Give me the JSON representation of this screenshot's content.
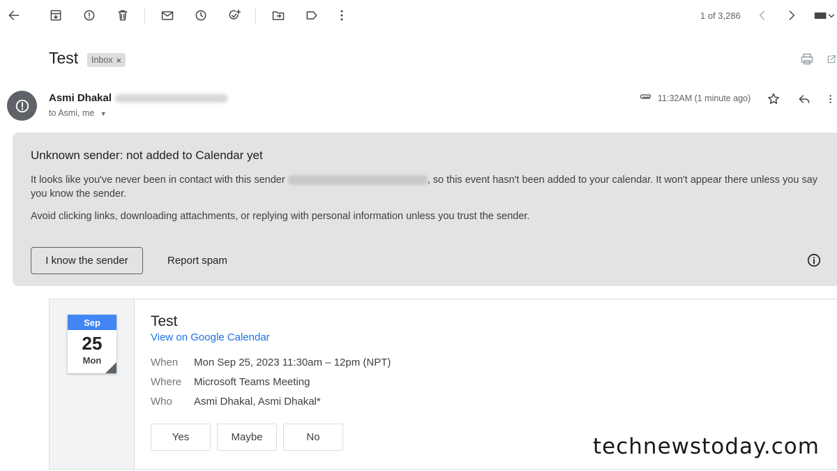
{
  "toolbar": {
    "pager": "1 of 3,286"
  },
  "message": {
    "subject": "Test",
    "label": "Inbox",
    "label_close": "×",
    "sender_name": "Asmi Dhakal",
    "recipients": "to Asmi, me",
    "time": "11:32AM (1 minute ago)"
  },
  "warning": {
    "title": "Unknown sender: not added to Calendar yet",
    "body_before": "It looks like you've never been in contact with this sender",
    "body_after": ", so this event hasn't been added to your calendar. It won't appear there unless you say you know the sender.",
    "body2": "Avoid clicking links, downloading attachments, or replying with personal information unless you trust the sender.",
    "know_button": "I know the sender",
    "spam_button": "Report spam"
  },
  "invite": {
    "cal_month": "Sep",
    "cal_day": "25",
    "cal_dow": "Mon",
    "title": "Test",
    "link": "View on Google Calendar",
    "when_label": "When",
    "when_value": "Mon Sep 25, 2023 11:30am – 12pm (NPT)",
    "where_label": "Where",
    "where_value": "Microsoft Teams Meeting",
    "who_label": "Who",
    "who_value": "Asmi Dhakal, Asmi Dhakal*",
    "yes": "Yes",
    "maybe": "Maybe",
    "no": "No"
  },
  "watermark": "technewstoday.com"
}
